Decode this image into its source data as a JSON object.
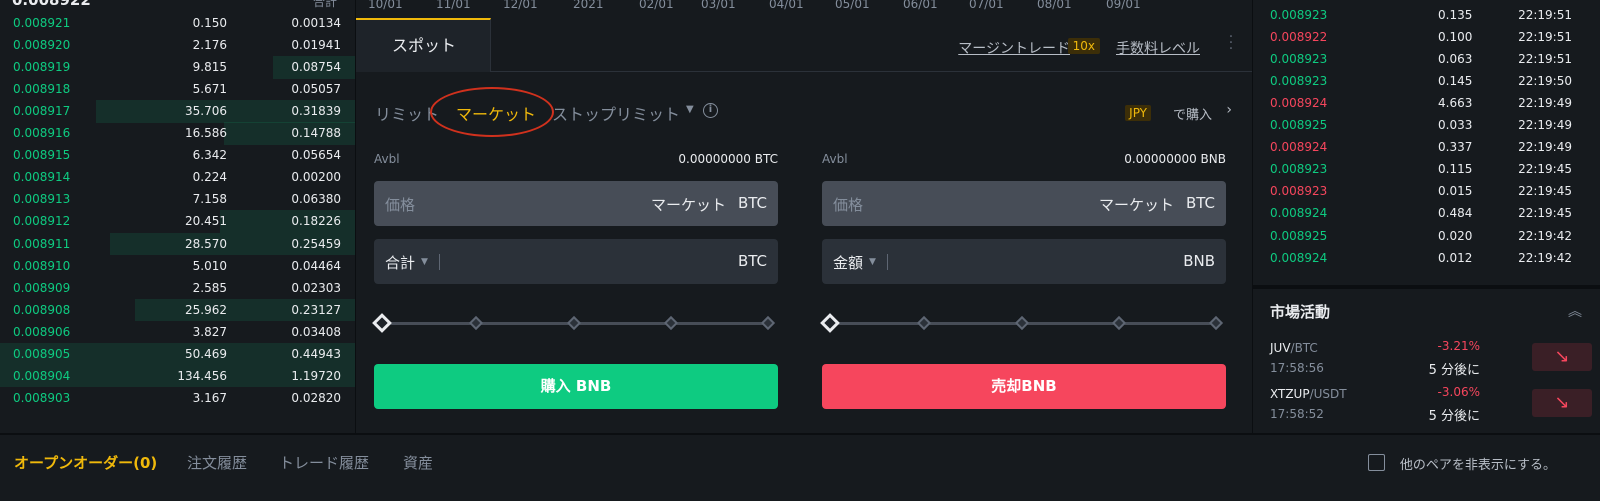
{
  "orderbook": {
    "header_fragment": "0.008922",
    "header_right_fragment": "合計",
    "rows": [
      {
        "price": "0.008921",
        "amount": "0.150",
        "total": "0.00134",
        "depth": 0.0
      },
      {
        "price": "0.008920",
        "amount": "2.176",
        "total": "0.01941",
        "depth": 0.0
      },
      {
        "price": "0.008919",
        "amount": "9.815",
        "total": "0.08754",
        "depth": 0.23
      },
      {
        "price": "0.008918",
        "amount": "5.671",
        "total": "0.05057",
        "depth": 0.0
      },
      {
        "price": "0.008917",
        "amount": "35.706",
        "total": "0.31839",
        "depth": 0.73
      },
      {
        "price": "0.008916",
        "amount": "16.586",
        "total": "0.14788",
        "depth": 0.37
      },
      {
        "price": "0.008915",
        "amount": "6.342",
        "total": "0.05654",
        "depth": 0.0
      },
      {
        "price": "0.008914",
        "amount": "0.224",
        "total": "0.00200",
        "depth": 0.0
      },
      {
        "price": "0.008913",
        "amount": "7.158",
        "total": "0.06380",
        "depth": 0.0
      },
      {
        "price": "0.008912",
        "amount": "20.451",
        "total": "0.18226",
        "depth": 0.38
      },
      {
        "price": "0.008911",
        "amount": "28.570",
        "total": "0.25459",
        "depth": 0.69
      },
      {
        "price": "0.008910",
        "amount": "5.010",
        "total": "0.04464",
        "depth": 0.0
      },
      {
        "price": "0.008909",
        "amount": "2.585",
        "total": "0.02303",
        "depth": 0.0
      },
      {
        "price": "0.008908",
        "amount": "25.962",
        "total": "0.23127",
        "depth": 0.62
      },
      {
        "price": "0.008906",
        "amount": "3.827",
        "total": "0.03408",
        "depth": 0.0
      },
      {
        "price": "0.008905",
        "amount": "50.469",
        "total": "0.44943",
        "depth": 1.0
      },
      {
        "price": "0.008904",
        "amount": "134.456",
        "total": "1.19720",
        "depth": 1.0
      },
      {
        "price": "0.008903",
        "amount": "3.167",
        "total": "0.02820",
        "depth": 0.0
      }
    ]
  },
  "chart_axis": {
    "labels": [
      "10/01",
      "11/01",
      "12/01",
      "2021",
      "02/01",
      "03/01",
      "04/01",
      "05/01",
      "06/01",
      "07/01",
      "08/01",
      "09/01"
    ]
  },
  "tabs": {
    "spot": "スポット",
    "margin_trade": "マージントレード",
    "leverage": "10x",
    "fee_level": "手数料レベル"
  },
  "order_types": {
    "limit": "リミット",
    "market": "マーケット",
    "stop_limit": "ストップリミット",
    "info": "i",
    "jpy_badge": "JPY",
    "buy_with": "で購入"
  },
  "buy_form": {
    "avbl_label": "Avbl",
    "avbl_value": "0.00000000 BTC",
    "price_placeholder": "価格",
    "price_mode": "マーケット",
    "price_unit": "BTC",
    "total_label": "合計",
    "total_unit": "BTC",
    "slider_percent": 0,
    "button_label": "購入 BNB"
  },
  "sell_form": {
    "avbl_label": "Avbl",
    "avbl_value": "0.00000000 BNB",
    "price_placeholder": "価格",
    "price_mode": "マーケット",
    "price_unit": "BTC",
    "amount_label": "金額",
    "amount_unit": "BNB",
    "slider_percent": 0,
    "button_label": "売却BNB"
  },
  "trades": [
    {
      "price": "0.008923",
      "amount": "0.135",
      "time": "22:19:51",
      "dir": "up"
    },
    {
      "price": "0.008922",
      "amount": "0.100",
      "time": "22:19:51",
      "dir": "down"
    },
    {
      "price": "0.008923",
      "amount": "0.063",
      "time": "22:19:51",
      "dir": "up"
    },
    {
      "price": "0.008923",
      "amount": "0.145",
      "time": "22:19:50",
      "dir": "up"
    },
    {
      "price": "0.008924",
      "amount": "4.663",
      "time": "22:19:49",
      "dir": "down"
    },
    {
      "price": "0.008925",
      "amount": "0.033",
      "time": "22:19:49",
      "dir": "up"
    },
    {
      "price": "0.008924",
      "amount": "0.337",
      "time": "22:19:49",
      "dir": "down"
    },
    {
      "price": "0.008923",
      "amount": "0.115",
      "time": "22:19:45",
      "dir": "up"
    },
    {
      "price": "0.008923",
      "amount": "0.015",
      "time": "22:19:45",
      "dir": "down"
    },
    {
      "price": "0.008924",
      "amount": "0.484",
      "time": "22:19:45",
      "dir": "up"
    },
    {
      "price": "0.008925",
      "amount": "0.020",
      "time": "22:19:42",
      "dir": "up"
    },
    {
      "price": "0.008924",
      "amount": "0.012",
      "time": "22:19:42",
      "dir": "up"
    }
  ],
  "market_activity": {
    "title": "市場活動",
    "items": [
      {
        "base": "JUV",
        "quote": "/BTC",
        "time": "17:58:56",
        "change": "-3.21%",
        "when": "5 分後に"
      },
      {
        "base": "XTZUP",
        "quote": "/USDT",
        "time": "17:58:52",
        "change": "-3.06%",
        "when": "5 分後に"
      }
    ]
  },
  "bottom_tabs": {
    "open_orders": "オープンオーダー(0)",
    "order_history": "注文履歴",
    "trade_history": "トレード履歴",
    "assets": "資産",
    "hide_pairs": "他のペアを非表示にする。"
  },
  "colors": {
    "accent": "#f0b90b",
    "buy": "#0ecb81",
    "sell": "#f6465d",
    "highlight_circle": "#d0311d"
  }
}
